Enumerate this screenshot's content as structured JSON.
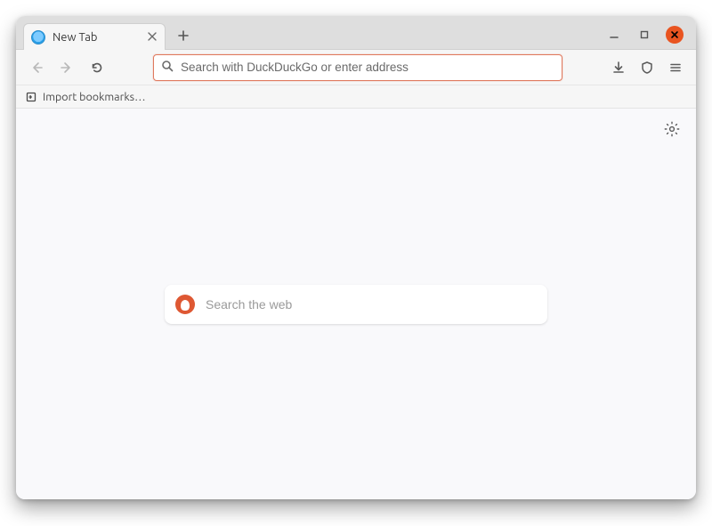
{
  "tab": {
    "title": "New Tab"
  },
  "urlbar": {
    "placeholder": "Search with DuckDuckGo or enter address",
    "value": ""
  },
  "bookmarks": {
    "import_label": "Import bookmarks…"
  },
  "newtab_search": {
    "placeholder": "Search the web"
  },
  "icons": {
    "favicon": "firefox-icon",
    "tab_close": "close-icon",
    "new_tab": "plus-icon",
    "win_min": "minimize-icon",
    "win_max": "maximize-icon",
    "win_close": "close-icon",
    "nav_back": "arrow-left-icon",
    "nav_forward": "arrow-right-icon",
    "nav_reload": "reload-icon",
    "url_search": "search-icon",
    "downloads": "download-icon",
    "shield": "shield-icon",
    "menu": "hamburger-icon",
    "import": "import-icon",
    "settings": "gear-icon",
    "ddg": "duckduckgo-logo"
  },
  "colors": {
    "accent": "#e07a5f",
    "close": "#e95420",
    "ddg": "#de5833"
  }
}
